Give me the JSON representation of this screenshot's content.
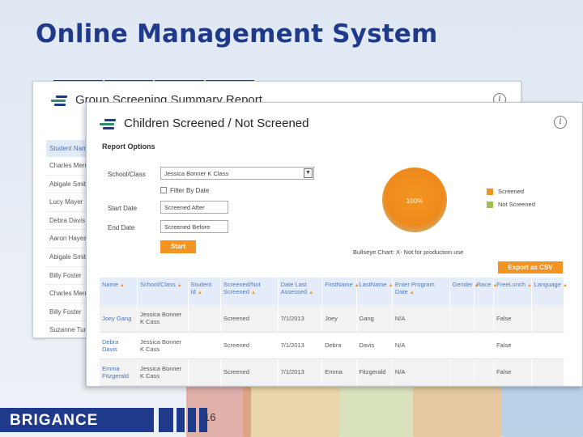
{
  "slide": {
    "title": "Online Management System",
    "page_number": "16",
    "brand": "BRIGANCE"
  },
  "back_window": {
    "title": "Group Screening Summary Report",
    "list_header": "Student Name",
    "students": [
      "Charles Merri",
      "Abigale Smith",
      "Lucy Mayer",
      "Debra Davis",
      "Aaron Hayes",
      "Abigale Smith",
      "Billy Foster",
      "Charles Merri",
      "Billy Foster",
      "Suzanne Turi"
    ]
  },
  "front_window": {
    "title": "Children Screened / Not Screened",
    "report_options_label": "Report Options",
    "school_class_label": "School/Class",
    "school_class_value": "Jessica Bonner K Class",
    "filter_by_date_label": "Filter By Date",
    "start_date_label": "Start Date",
    "start_date_placeholder": "Screened After",
    "end_date_label": "End Date",
    "end_date_placeholder": "Screened Before",
    "start_button": "Start",
    "pie_label": "100%",
    "legend": [
      {
        "label": "Screened",
        "color": "#f39321"
      },
      {
        "label": "Not Screened",
        "color": "#9dc04a"
      }
    ],
    "chart_note": "Bullseye Chart: X- Not for production use",
    "export_button": "Export as CSV",
    "columns": [
      "Name",
      "School/Class",
      "Student Id",
      "Screened/Not Screened",
      "Date Last Assessed",
      "FirstName",
      "LastName",
      "Enter Program Date",
      "Gender",
      "Race",
      "FreeLunch",
      "Language"
    ],
    "rows": [
      [
        "Joey Gang",
        "Jessica Bonner K Cass",
        "",
        "Screened",
        "7/1/2013",
        "Joey",
        "Gang",
        "N/A",
        "",
        "",
        "False",
        ""
      ],
      [
        "Debra Davis",
        "Jessica Bonner K Cass",
        "",
        "Screened",
        "7/1/2013",
        "Debra",
        "Davis",
        "N/A",
        "",
        "",
        "False",
        ""
      ],
      [
        "Emma Fitzgerald",
        "Jessica Bonner K Cass",
        "",
        "Screened",
        "7/1/2013",
        "Emma",
        "Fitzgerald",
        "N/A",
        "",
        "",
        "False",
        ""
      ]
    ]
  }
}
